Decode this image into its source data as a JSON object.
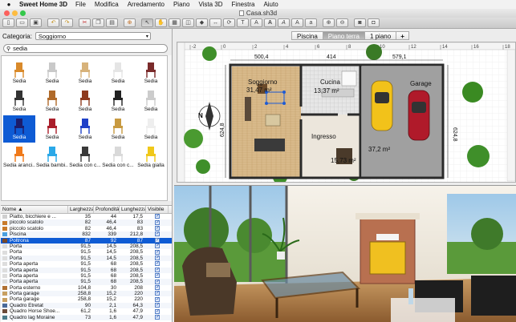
{
  "menubar": {
    "app": "Sweet Home 3D",
    "items": [
      "File",
      "Modifica",
      "Arredamento",
      "Piano",
      "Vista 3D",
      "Finestra",
      "Aiuto"
    ]
  },
  "window": {
    "title": "Casa.sh3d"
  },
  "toolbar": {
    "buttons": [
      "new-icon",
      "open-icon",
      "save-icon",
      "cut-icon",
      "undo-icon",
      "redo-icon",
      "cut2-icon",
      "copy-icon",
      "paste-icon",
      "add-furniture-icon",
      "select-icon",
      "pan-icon",
      "create-walls-icon",
      "create-rooms-icon",
      "create-polylines-icon",
      "create-dimensions-icon",
      "add-text-icon",
      "text-style-icon",
      "bold-icon",
      "italic-icon",
      "increase-text-icon",
      "decrease-text-icon",
      "zoom-in-icon",
      "zoom-out-icon",
      "photo-icon",
      "video-icon"
    ]
  },
  "catalog": {
    "category_label": "Categoria:",
    "category_value": "Soggiorno",
    "search_value": "sedia",
    "items": [
      {
        "name": "Sedia",
        "color": "#d98a2b"
      },
      {
        "name": "Sedia",
        "color": "#c9c9c9"
      },
      {
        "name": "Sedia",
        "color": "#d7b27a"
      },
      {
        "name": "Sedia",
        "color": "#e5e5e5"
      },
      {
        "name": "Sedia",
        "color": "#7a2b2b"
      },
      {
        "name": "Sedia",
        "color": "#333333"
      },
      {
        "name": "Sedia",
        "color": "#b06a2a"
      },
      {
        "name": "Sedia",
        "color": "#8e3a1e"
      },
      {
        "name": "Sedia",
        "color": "#222222"
      },
      {
        "name": "Sedia",
        "color": "#cccccc"
      },
      {
        "name": "Sedia",
        "color": "#1c1c6a"
      },
      {
        "name": "Sedia",
        "color": "#aa1e2a"
      },
      {
        "name": "Sedia",
        "color": "#1f40c8"
      },
      {
        "name": "Sedia",
        "color": "#c89a40"
      },
      {
        "name": "Sedia",
        "color": "#eeeeee"
      },
      {
        "name": "Sedia aranci...",
        "color": "#f07a1a"
      },
      {
        "name": "Sedia bambi...",
        "color": "#2aa8e8"
      },
      {
        "name": "Sedia con c...",
        "color": "#3a3a3a"
      },
      {
        "name": "Sedia con c...",
        "color": "#d9d9d9"
      },
      {
        "name": "Sedia gialla",
        "color": "#f0c81a"
      }
    ],
    "selected_index": 10
  },
  "furniture_table": {
    "headers": [
      "Nome ▲",
      "Larghezza",
      "Profondità",
      "Lunghezza",
      "Visibile"
    ],
    "rows": [
      {
        "name": "Piatto, bicchiere e ...",
        "w": "35",
        "d": "44",
        "h": "17,5",
        "color": "#cfcfcf"
      },
      {
        "name": "piccolo scatolo",
        "w": "82",
        "d": "46,4",
        "h": "83",
        "color": "#c87a2a"
      },
      {
        "name": "piccolo scatolo",
        "w": "82",
        "d": "46,4",
        "h": "83",
        "color": "#c87a2a"
      },
      {
        "name": "Piscina",
        "w": "832",
        "d": "339",
        "h": "212,8",
        "color": "#4aa0e0"
      },
      {
        "name": "Poltrona",
        "w": "87",
        "d": "92",
        "h": "87",
        "color": "#7a4a2a"
      },
      {
        "name": "Porta",
        "w": "91,5",
        "d": "14,5",
        "h": "208,5",
        "color": "#dddddd"
      },
      {
        "name": "Porta",
        "w": "91,5",
        "d": "14,5",
        "h": "208,5",
        "color": "#dddddd"
      },
      {
        "name": "Porta",
        "w": "91,5",
        "d": "14,5",
        "h": "208,5",
        "color": "#dddddd"
      },
      {
        "name": "Porta aperta",
        "w": "91,5",
        "d": "68",
        "h": "208,5",
        "color": "#dddddd"
      },
      {
        "name": "Porta aperta",
        "w": "91,5",
        "d": "68",
        "h": "208,5",
        "color": "#dddddd"
      },
      {
        "name": "Porta aperta",
        "w": "91,5",
        "d": "68",
        "h": "208,5",
        "color": "#dddddd"
      },
      {
        "name": "Porta aperta",
        "w": "91,5",
        "d": "68",
        "h": "208,5",
        "color": "#dddddd"
      },
      {
        "name": "Porta esterno",
        "w": "104,8",
        "d": "30",
        "h": "208",
        "color": "#b07030"
      },
      {
        "name": "Porta garage",
        "w": "258,8",
        "d": "15,2",
        "h": "220",
        "color": "#c8a060"
      },
      {
        "name": "Porta garage",
        "w": "258,8",
        "d": "15,2",
        "h": "220",
        "color": "#c8a060"
      },
      {
        "name": "Quadro Etretat",
        "w": "90",
        "d": "2,1",
        "h": "64,3",
        "color": "#4a6a9a"
      },
      {
        "name": "Quadro Horse Shoe...",
        "w": "61,2",
        "d": "1,6",
        "h": "47,9",
        "color": "#6a4a3a"
      },
      {
        "name": "Quadro lag Moraine",
        "w": "73",
        "d": "1,6",
        "h": "47,9",
        "color": "#4a7a8a"
      }
    ],
    "selected_index": 4
  },
  "plan": {
    "tabs": [
      "Piscina",
      "Piano terra",
      "1 piano",
      "+"
    ],
    "active_tab": 1,
    "ruler_ticks": [
      "-2",
      "0",
      "2",
      "4",
      "6",
      "8",
      "10",
      "12",
      "14",
      "16",
      "18"
    ],
    "rooms": [
      {
        "name": "Soggiorno",
        "area": "31,47 m²"
      },
      {
        "name": "Cucina",
        "area": "13,37 m²"
      },
      {
        "name": "Garage",
        "area": "37,2 m²"
      },
      {
        "name": "Ingresso",
        "area": "15,73 m²"
      }
    ],
    "dimensions": [
      "500,4",
      "414",
      "579,1",
      "624,8",
      "624,8"
    ],
    "north_label": "N"
  },
  "colors": {
    "selection": "#0e5bd4",
    "wall": "#2a2a2a",
    "parquet": "#d8b98a",
    "tile": "#9a9a9a",
    "grass": "#3f8f2a"
  }
}
